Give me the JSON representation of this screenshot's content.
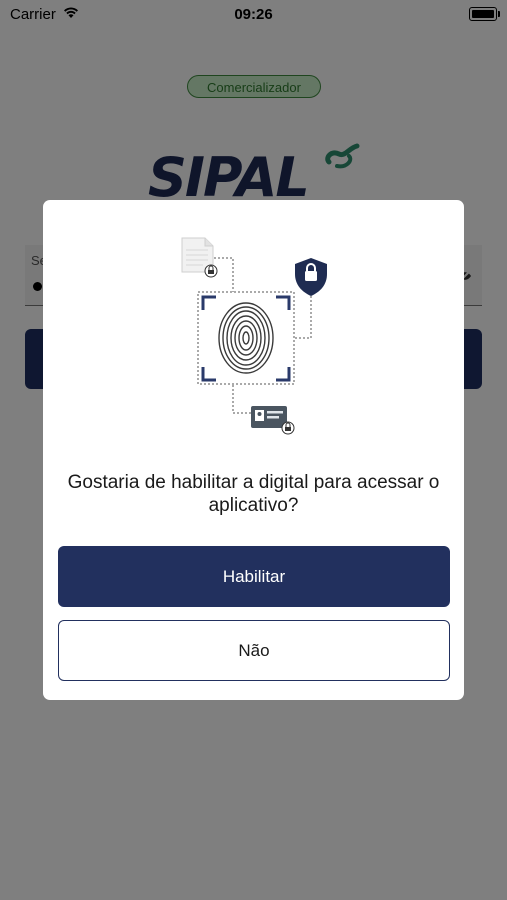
{
  "statusbar": {
    "carrier": "Carrier",
    "time": "09:26",
    "icons": [
      "wifi-icon",
      "battery-icon"
    ]
  },
  "background": {
    "role_badge": "Comercializador",
    "logo_text": "SIPAL",
    "password_label": "Se",
    "password_value": "●"
  },
  "modal": {
    "question": "Gostaria de habilitar a digital para acessar o aplicativo?",
    "enable_button": "Habilitar",
    "decline_button": "Não",
    "illustration_icons": [
      "document-lock-icon",
      "shield-lock-icon",
      "fingerprint-icon",
      "id-card-lock-icon"
    ]
  },
  "colors": {
    "primary": "#22305e",
    "badge_green": "#3e8b3e",
    "overlay": "rgba(0,0,0,0.5)"
  }
}
